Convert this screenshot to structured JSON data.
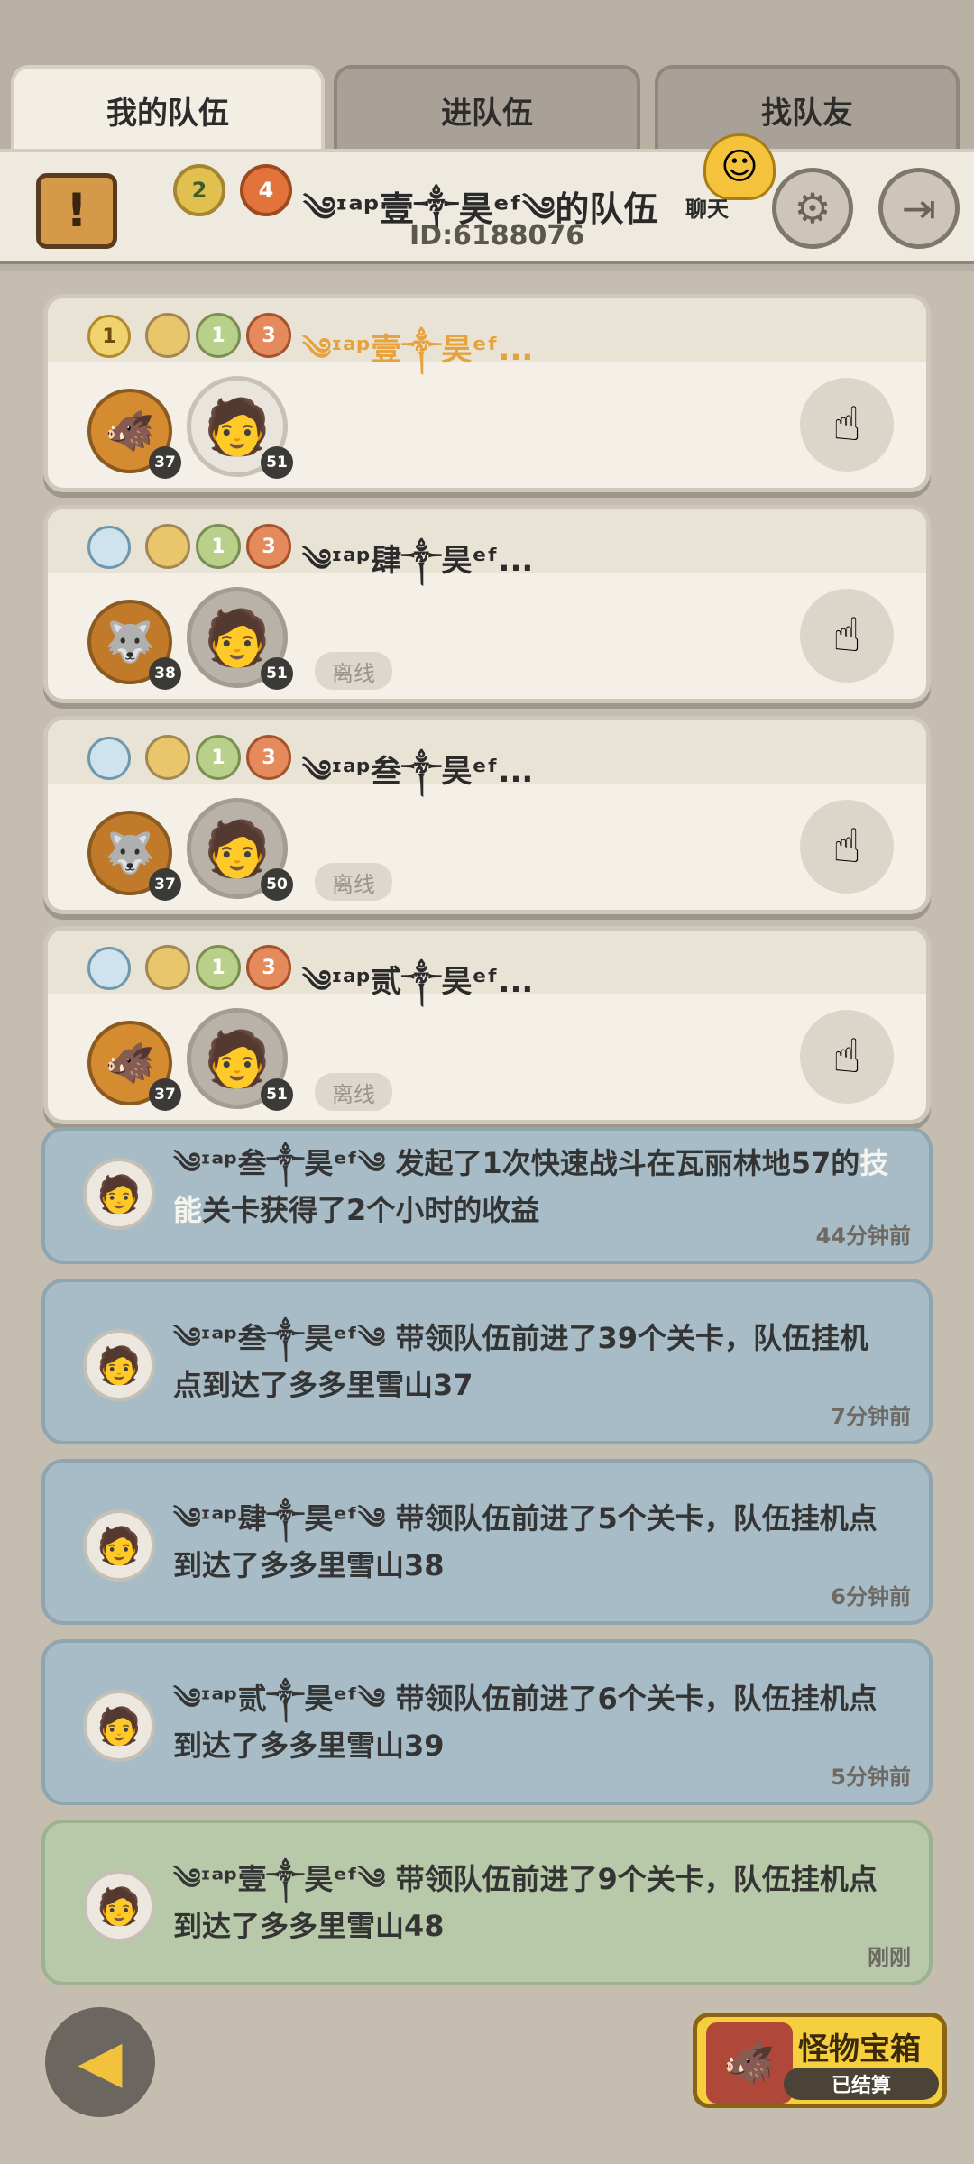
{
  "tabs": [
    {
      "label": "我的队伍"
    },
    {
      "label": "进队伍"
    },
    {
      "label": "找队友"
    }
  ],
  "header": {
    "team_name": "༄ᶦᵃᵖ壹༒昊ᵉᶠ༄的队伍",
    "team_id": "ID:6188076",
    "badges": [
      "2",
      "4"
    ],
    "chat_label": "聊天"
  },
  "members": [
    {
      "name": "༄ᶦᵃᵖ壹༒昊ᵉᶠ...",
      "rank": "1",
      "badges": [
        "",
        "1",
        "3"
      ],
      "pet_level": "37",
      "hero_level": "51",
      "status": "",
      "leader": true
    },
    {
      "name": "༄ᶦᵃᵖ肆༒昊ᵉᶠ...",
      "rank": "",
      "badges": [
        "",
        "1",
        "3"
      ],
      "pet_level": "38",
      "hero_level": "51",
      "status": "离线",
      "leader": false
    },
    {
      "name": "༄ᶦᵃᵖ叁༒昊ᵉᶠ...",
      "rank": "",
      "badges": [
        "",
        "1",
        "3"
      ],
      "pet_level": "37",
      "hero_level": "50",
      "status": "离线",
      "leader": false
    },
    {
      "name": "༄ᶦᵃᵖ贰༒昊ᵉᶠ...",
      "rank": "",
      "badges": [
        "",
        "1",
        "3"
      ],
      "pet_level": "37",
      "hero_level": "51",
      "status": "离线",
      "leader": false
    }
  ],
  "log": [
    {
      "pre": "༄ᶦᵃᵖ叁༒昊ᵉᶠ༄ 发起了1次快速战斗在瓦丽林地57的",
      "hl": "技能",
      "post": "关卡获得了2个小时的收益",
      "time": "44分钟前"
    },
    {
      "pre": "༄ᶦᵃᵖ叁༒昊ᵉᶠ༄ 带领队伍前进了39个关卡，队伍挂机点到达了多多里雪山37",
      "hl": "",
      "post": "",
      "time": "7分钟前"
    },
    {
      "pre": "༄ᶦᵃᵖ肆༒昊ᵉᶠ༄ 带领队伍前进了5个关卡，队伍挂机点到达了多多里雪山38",
      "hl": "",
      "post": "",
      "time": "6分钟前"
    },
    {
      "pre": "༄ᶦᵃᵖ贰༒昊ᵉᶠ༄ 带领队伍前进了6个关卡，队伍挂机点到达了多多里雪山39",
      "hl": "",
      "post": "",
      "time": "5分钟前"
    },
    {
      "pre": "༄ᶦᵃᵖ壹༒昊ᵉᶠ༄ 带领队伍前进了9个关卡，队伍挂机点到达了多多里雪山48",
      "hl": "",
      "post": "",
      "time": "刚刚"
    }
  ],
  "bottom": {
    "chest_title": "怪物宝箱",
    "chest_status": "已结算"
  },
  "icons": {
    "scroll": "scroll-icon",
    "settings": "gear-icon",
    "exit": "exit-icon",
    "chat": "chat-bubble-icon",
    "back": "back-arrow-icon",
    "rank": "rank-shield-icon",
    "pet": "pet-avatar",
    "hero": "hero-avatar",
    "action": "pointing-hand-icon"
  }
}
